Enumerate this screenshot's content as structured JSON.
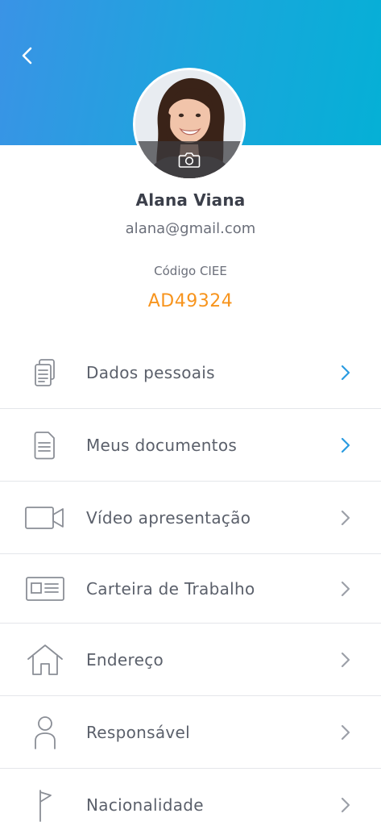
{
  "profile": {
    "name": "Alana Viana",
    "email": "alana@gmail.com",
    "code_label": "Código CIEE",
    "code_value": "AD49324"
  },
  "colors": {
    "header_gradient_start": "#3a93e6",
    "header_gradient_end": "#05b0d6",
    "accent_orange": "#f7941d",
    "chevron_active": "#2a9be0",
    "chevron_inactive": "#9ca0a8",
    "icon_gray": "#8a8e96"
  },
  "menu": {
    "items": [
      {
        "label": "Dados pessoais",
        "icon": "personal-data-icon",
        "chevron": "active"
      },
      {
        "label": "Meus documentos",
        "icon": "document-icon",
        "chevron": "active"
      },
      {
        "label": "Vídeo apresentação",
        "icon": "video-camera-icon",
        "chevron": "inactive"
      },
      {
        "label": "Carteira de Trabalho",
        "icon": "id-card-icon",
        "chevron": "inactive"
      },
      {
        "label": "Endereço",
        "icon": "home-icon",
        "chevron": "inactive"
      },
      {
        "label": "Responsável",
        "icon": "user-icon",
        "chevron": "inactive"
      },
      {
        "label": "Nacionalidade",
        "icon": "flag-icon",
        "chevron": "inactive"
      }
    ]
  }
}
